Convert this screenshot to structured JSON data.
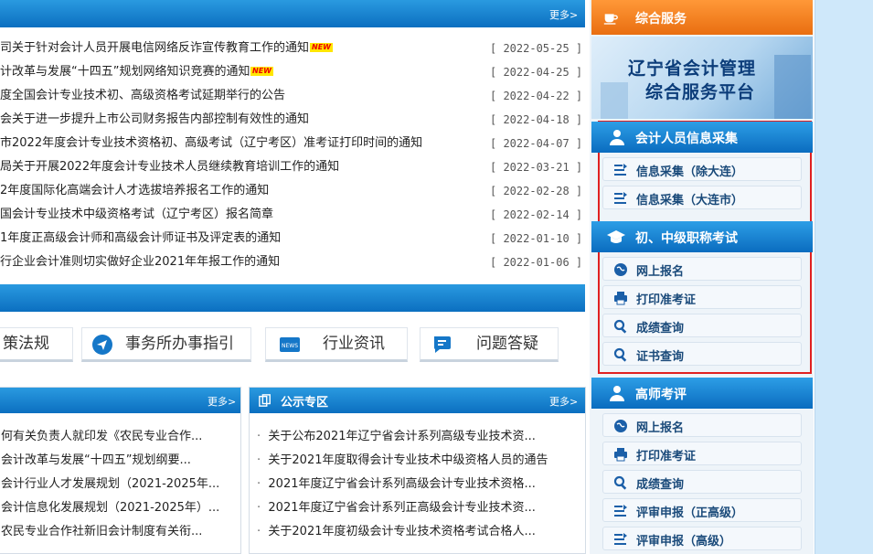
{
  "notices": {
    "more_label": "更多>",
    "items": [
      {
        "title": "司关于针对会计人员开展电信网络反诈宣传教育工作的通知",
        "is_new": true,
        "date": "[ 2022-05-25 ]"
      },
      {
        "title": "计改革与发展“十四五”规划网络知识竞赛的通知",
        "is_new": true,
        "date": "[ 2022-04-25 ]"
      },
      {
        "title": "度全国会计专业技术初、高级资格考试延期举行的公告",
        "is_new": false,
        "date": "[ 2022-04-22 ]"
      },
      {
        "title": "会关于进一步提升上市公司财务报告内部控制有效性的通知",
        "is_new": false,
        "date": "[ 2022-04-18 ]"
      },
      {
        "title": "市2022年度会计专业技术资格初、高级考试（辽宁考区）准考证打印时间的通知",
        "is_new": false,
        "date": "[ 2022-04-07 ]"
      },
      {
        "title": "局关于开展2022年度会计专业技术人员继续教育培训工作的通知",
        "is_new": false,
        "date": "[ 2022-03-21 ]"
      },
      {
        "title": "2年度国际化高端会计人才选拔培养报名工作的通知",
        "is_new": false,
        "date": "[ 2022-02-28 ]"
      },
      {
        "title": "国会计专业技术中级资格考试（辽宁考区）报名简章",
        "is_new": false,
        "date": "[ 2022-02-14 ]"
      },
      {
        "title": "1年度正高级会计师和高级会计师证书及评定表的通知",
        "is_new": false,
        "date": "[ 2022-01-10 ]"
      },
      {
        "title": "行企业会计准则切实做好企业2021年年报工作的通知",
        "is_new": false,
        "date": "[ 2022-01-06 ]"
      }
    ],
    "new_badge": "NEW"
  },
  "quick_links": [
    {
      "label": "策法规",
      "icon": "law-icon"
    },
    {
      "label": "事务所办事指引",
      "icon": "send-icon"
    },
    {
      "label": "行业资讯",
      "icon": "news-icon"
    },
    {
      "label": "问题答疑",
      "icon": "chat-icon"
    }
  ],
  "left_panel": {
    "more_label": "更多>",
    "items": [
      "何有关负责人就印发《农民专业合作...",
      "会计改革与发展“十四五”规划纲要...",
      "会计行业人才发展规划（2021-2025年...",
      "会计信息化发展规划（2021-2025年）...",
      "农民专业合作社新旧会计制度有关衔..."
    ]
  },
  "public_panel": {
    "title": "公示专区",
    "more_label": "更多>",
    "items": [
      "关于公布2021年辽宁省会计系列高级专业技术资...",
      "关于2021年度取得会计专业技术中级资格人员的通告",
      "2021年度辽宁省会计系列高级会计专业技术资格...",
      "2021年度辽宁省会计系列正高级会计专业技术资...",
      "关于2021年度初级会计专业技术资格考试合格人..."
    ]
  },
  "sidebar": {
    "service_title": "综合服务",
    "banner_line1": "辽宁省会计管理",
    "banner_line2": "综合服务平台",
    "info_collect": {
      "title": "会计人员信息采集",
      "buttons": [
        "信息采集（除大连）",
        "信息采集（大连市）"
      ]
    },
    "exam": {
      "title": "初、中级职称考试",
      "buttons": [
        "网上报名",
        "打印准考证",
        "成绩查询",
        "证书查询"
      ]
    },
    "senior": {
      "title": "高师考评",
      "buttons": [
        "网上报名",
        "打印准考证",
        "成绩查询",
        "评审申报（正高级）",
        "评审申报（高级）"
      ]
    }
  },
  "colors": {
    "header_blue": "#0b6fc0",
    "accent_orange": "#f07a1a",
    "highlight_red": "#e02020"
  }
}
